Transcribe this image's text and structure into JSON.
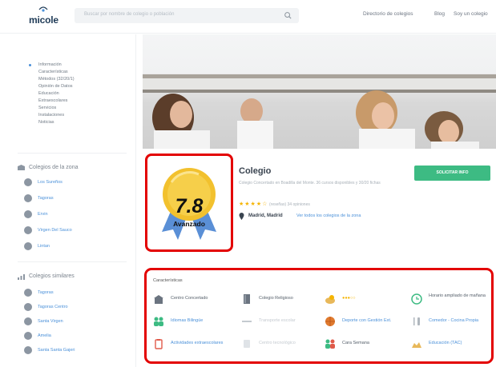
{
  "header": {
    "logo_text": "micole",
    "search_placeholder": "Buscar por nombre de colegio o población",
    "nav": [
      "Directorio de colegios",
      "Blog",
      "Soy un colegio"
    ]
  },
  "sidebar": {
    "menu": [
      "Información",
      "Características",
      "Métodos (32/20/1)",
      "Opinión de Datos",
      "Educación",
      "Extraescolares",
      "Servicios",
      "Instalaciones",
      "Noticias"
    ],
    "section_nearby": {
      "title": "Colegios de la zona",
      "items": [
        "Los Sureños",
        "Tagoras",
        "Ervin",
        "Virgen Del Sauco",
        "Lintan"
      ]
    },
    "section_similar": {
      "title": "Colegios similares",
      "items": [
        "Tagoras",
        "Tagoras Centro",
        "Santa Virgen",
        "Amelia",
        "Santa Santa Gajeri"
      ]
    }
  },
  "score": {
    "value": "7.8",
    "level": "Avanzado"
  },
  "school": {
    "name": "Colegio",
    "description": "Colegio Concertado en Boadilla del Monte. 36 cursos disponibles y 30/20 fichas",
    "stars": "★★★★☆",
    "reviews": "(reseñas) 34 opiniones",
    "location": "Madrid, Madrid",
    "location_link": "Ver todos los colegios de la zona",
    "info_button": "SOLICITAR INFO"
  },
  "features": {
    "title": "Características",
    "items": [
      {
        "label": "Centro Concertado",
        "style": "dark",
        "icon": "building-icon",
        "color": "#6b7480"
      },
      {
        "label": "Colegio Religioso",
        "style": "dark",
        "icon": "book-icon",
        "color": "#6b7480"
      },
      {
        "label": "●●●○○",
        "style": "dots",
        "icon": "price-icon",
        "color": "#f5b400"
      },
      {
        "label": "Horario ampliado de mañana",
        "style": "dark",
        "icon": "clock-icon",
        "color": "#3dbb83"
      },
      {
        "label": "Idiomas Bilingüe",
        "style": "blue",
        "icon": "people-icon",
        "color": "#3dbb83"
      },
      {
        "label": "Transporte escolar",
        "style": "grey",
        "icon": "bus-icon",
        "color": "#c4cad0"
      },
      {
        "label": "Deporte con Gestión Ext.",
        "style": "blue",
        "icon": "ball-icon",
        "color": "#e07a2e"
      },
      {
        "label": "Comedor - Cocina Propia",
        "style": "blue",
        "icon": "cutlery-icon",
        "color": "#b0b7be"
      },
      {
        "label": "Actividades extraescolares",
        "style": "blue",
        "icon": "clipboard-icon",
        "color": "#e05a4a"
      },
      {
        "label": "Centro tecnológico",
        "style": "grey",
        "icon": "tech-icon",
        "color": "#c4cad0"
      },
      {
        "label": "Cara Semana",
        "style": "dark",
        "icon": "group-icon",
        "color": "#3dbb83"
      },
      {
        "label": "Educación (TAC)",
        "style": "blue",
        "icon": "hands-icon",
        "color": "#e8b85a"
      }
    ]
  },
  "colors": {
    "brand": "#1f3b57",
    "accent_green": "#3dbb83",
    "highlight_red": "#e30000",
    "link_blue": "#4a90d9",
    "medal_gold": "#f2c12e",
    "medal_ribbon": "#5a8fd6"
  }
}
